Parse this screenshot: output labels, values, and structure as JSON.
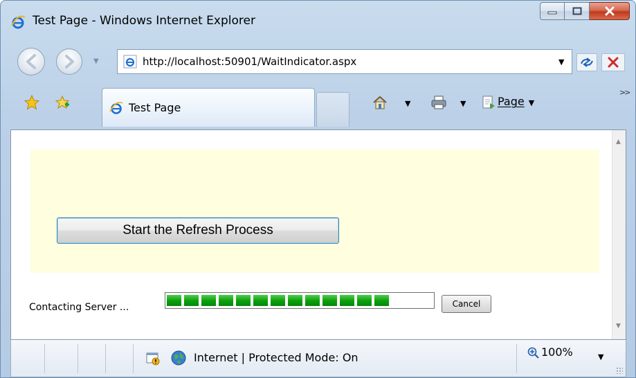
{
  "window": {
    "title": "Test Page - Windows Internet Explorer"
  },
  "address_bar": {
    "url": "http://localhost:50901/WaitIndicator.aspx"
  },
  "tabs": [
    {
      "label": "Test Page"
    }
  ],
  "command_bar": {
    "page_label": "Page"
  },
  "content": {
    "refresh_button_label": "Start the Refresh Process",
    "status_text": "Contacting Server ...",
    "cancel_button_label": "Cancel",
    "progress_segments_filled": 13,
    "progress_fraction": 0.86
  },
  "status_bar": {
    "zone_text": "Internet | Protected Mode: On",
    "zoom_text": "100%"
  },
  "colors": {
    "panel_background": "#ffffe0",
    "progress_green": "#0a9e0a",
    "button_border": "#3c7fb1"
  }
}
